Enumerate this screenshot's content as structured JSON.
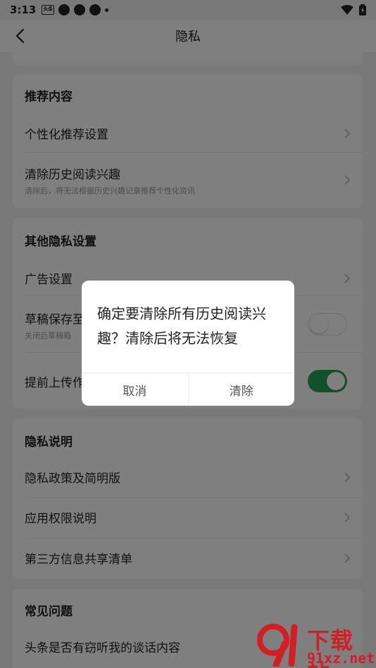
{
  "status_bar": {
    "time": "3:13",
    "app_badge": "头条"
  },
  "nav": {
    "title": "隐私"
  },
  "sections": {
    "recommend": {
      "title": "推荐内容",
      "items": [
        {
          "label": "个性化推荐设置"
        },
        {
          "label": "清除历史阅读兴趣",
          "subtitle": "清除后，将无法根据历史兴趣记录推荐个性化资讯"
        }
      ]
    },
    "other": {
      "title": "其他隐私设置",
      "items": [
        {
          "label": "广告设置"
        },
        {
          "label": "草稿保存至",
          "subtitle": "关闭后草稿箱",
          "toggle": "off"
        },
        {
          "label": "提前上传作",
          "toggle": "on"
        }
      ]
    },
    "privacy_info": {
      "title": "隐私说明",
      "items": [
        {
          "label": "隐私政策及简明版"
        },
        {
          "label": "应用权限说明"
        },
        {
          "label": "第三方信息共享清单"
        }
      ]
    },
    "faq": {
      "title": "常见问题",
      "items": [
        {
          "label": "头条是否有窃听我的谈话内容"
        }
      ]
    }
  },
  "dialog": {
    "message": "确定要清除所有历史阅读兴趣？清除后将无法恢复",
    "cancel": "取消",
    "confirm": "清除"
  },
  "watermark": {
    "text": "下载站",
    "url": "91xz.net"
  },
  "colors": {
    "toggle_on": "#27a35a",
    "watermark": "#d21f26"
  }
}
